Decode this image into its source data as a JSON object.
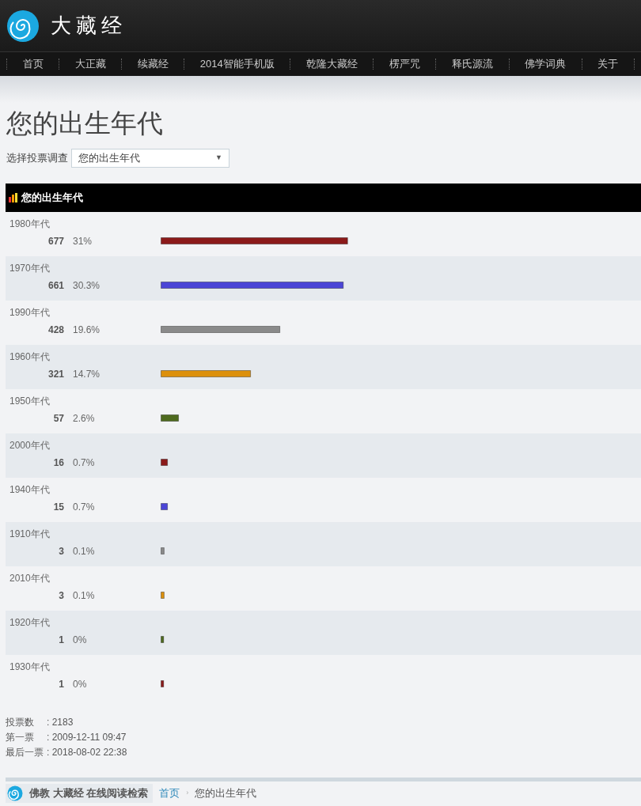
{
  "site": {
    "title": "大藏经"
  },
  "nav": [
    {
      "label": "首页"
    },
    {
      "label": "大正藏"
    },
    {
      "label": "续藏经"
    },
    {
      "label": "2014智能手机版"
    },
    {
      "label": "乾隆大藏经"
    },
    {
      "label": "楞严咒"
    },
    {
      "label": "释氏源流"
    },
    {
      "label": "佛学词典"
    },
    {
      "label": "关于"
    }
  ],
  "page_title": "您的出生年代",
  "poll_select": {
    "label": "选择投票调查",
    "value": "您的出生年代",
    "arrow": "▼"
  },
  "poll": {
    "title": "您的出生年代",
    "options": [
      {
        "label": "1980年代",
        "votes": "677",
        "percent": "31%",
        "level": 0.39,
        "color": "#8b1a1a"
      },
      {
        "label": "1970年代",
        "votes": "661",
        "percent": "30.3%",
        "level": 0.381,
        "color": "#4b45d6"
      },
      {
        "label": "1990年代",
        "votes": "428",
        "percent": "19.6%",
        "level": 0.249,
        "color": "#8a8a8a"
      },
      {
        "label": "1960年代",
        "votes": "321",
        "percent": "14.7%",
        "level": 0.188,
        "color": "#dc900c"
      },
      {
        "label": "1950年代",
        "votes": "57",
        "percent": "2.6%",
        "level": 0.038,
        "color": "#4e6a1e"
      },
      {
        "label": "2000年代",
        "votes": "16",
        "percent": "0.7%",
        "level": 0.015,
        "color": "#8b1a1a"
      },
      {
        "label": "1940年代",
        "votes": "15",
        "percent": "0.7%",
        "level": 0.015,
        "color": "#4b45d6"
      },
      {
        "label": "1910年代",
        "votes": "3",
        "percent": "0.1%",
        "level": 0.008,
        "color": "#8a8a8a"
      },
      {
        "label": "2010年代",
        "votes": "3",
        "percent": "0.1%",
        "level": 0.008,
        "color": "#dc900c"
      },
      {
        "label": "1920年代",
        "votes": "1",
        "percent": "0%",
        "level": 0.007,
        "color": "#4e6a1e"
      },
      {
        "label": "1930年代",
        "votes": "1",
        "percent": "0%",
        "level": 0.007,
        "color": "#8b1a1a"
      }
    ]
  },
  "stats": [
    {
      "label": "投票数",
      "value": ": 2183"
    },
    {
      "label": "第一票",
      "value": ": 2009-12-11 09:47"
    },
    {
      "label": "最后一票",
      "value": ": 2018-08-02 22:38"
    }
  ],
  "footer": {
    "brand": "佛教 大藏经 在线阅读检索",
    "separator": "›",
    "breadcrumb": [
      {
        "label": "首页",
        "kind": "link"
      },
      {
        "label": "您的出生年代",
        "kind": "current"
      }
    ]
  }
}
